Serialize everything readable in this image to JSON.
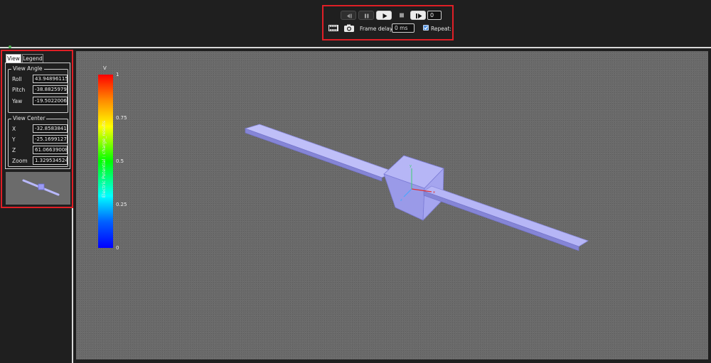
{
  "playback": {
    "frame_number": "0",
    "frame_delay_label": "Frame delay:",
    "frame_delay_value": "0 ms",
    "repeat_label": "Repeat:",
    "repeat_checked": true,
    "buttons": [
      "step-back",
      "pause",
      "play",
      "stop",
      "step-forward"
    ],
    "icons": [
      "film-strip-icon",
      "camera-icon"
    ]
  },
  "panel": {
    "tabs": [
      "View",
      "Legend"
    ],
    "active_tab": "View",
    "view_angle": {
      "title": "View Angle",
      "roll_label": "Roll",
      "roll": "43.9489611534",
      "pitch_label": "Pitch",
      "pitch": "-38.882597967",
      "yaw_label": "Yaw",
      "yaw": "-19.502200675"
    },
    "view_center": {
      "title": "View Center",
      "x_label": "X",
      "x": "-32.858384102",
      "y_label": "Y",
      "y": "-25.169912763",
      "z_label": "Z",
      "z": "61.0663900813",
      "zoom_label": "Zoom",
      "zoom": "1.32953452493"
    }
  },
  "viewport": {
    "unit": "V",
    "colorbar_title": "Electric Potential : charge_results",
    "ticks": [
      "1",
      "0.75",
      "0.5",
      "0.25",
      "0"
    ],
    "colors": {
      "highlight": "#e01f26",
      "model": "#9b9bf5"
    }
  }
}
